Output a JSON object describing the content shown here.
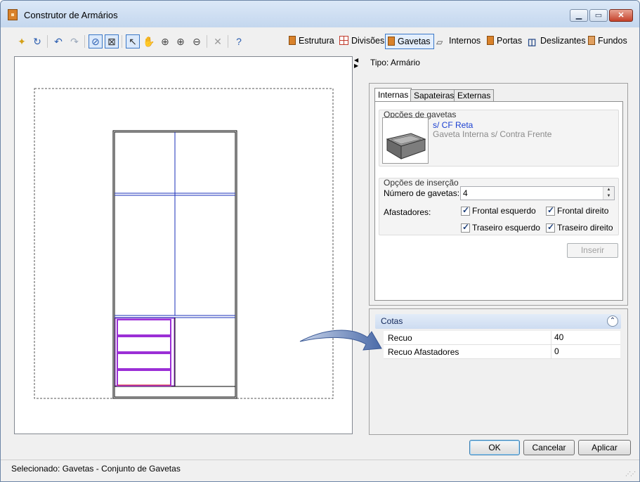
{
  "window": {
    "title": "Construtor de Armários"
  },
  "toolbar": {
    "icons": [
      "new-icon",
      "refresh-icon",
      "undo-icon",
      "redo-icon",
      "view-mode-icon",
      "frame-mode-icon",
      "select-pointer-icon",
      "pan-hand-icon",
      "zoom-extents-icon",
      "zoom-in-icon",
      "zoom-out-icon",
      "delete-icon",
      "help-icon"
    ],
    "tabs": [
      {
        "label": "Estrutura",
        "icon": "cabinet-icon"
      },
      {
        "label": "Divisões",
        "icon": "grid-icon"
      },
      {
        "label": "Gavetas",
        "icon": "drawer-icon",
        "active": true
      },
      {
        "label": "Internos",
        "icon": "internals-icon"
      },
      {
        "label": "Portas",
        "icon": "door-icon"
      },
      {
        "label": "Deslizantes",
        "icon": "sliding-doors-icon"
      },
      {
        "label": "Fundos",
        "icon": "back-panel-icon"
      }
    ]
  },
  "tipo": {
    "text": "Tipo: Armário"
  },
  "subtabs": [
    "Internas",
    "Sapateiras",
    "Externas"
  ],
  "opcoes_gavetas": {
    "title": "Opções de gavetas",
    "item_title": "s/ CF Reta",
    "item_subtitle": "Gaveta Interna s/ Contra Frente"
  },
  "opcoes_insercao": {
    "title": "Opções de inserção",
    "num_label": "Número de gavetas:",
    "num_value": "4",
    "afastadores_label": "Afastadores:",
    "checkboxes": {
      "frontal_esquerdo": "Frontal esquerdo",
      "frontal_direito": "Frontal direito",
      "traseiro_esquerdo": "Traseiro esquerdo",
      "traseiro_direito": "Traseiro direito"
    },
    "inserir": "Inserir"
  },
  "cotas": {
    "title": "Cotas",
    "rows": [
      {
        "name": "Recuo",
        "value": "40"
      },
      {
        "name": "Recuo Afastadores",
        "value": "0"
      }
    ]
  },
  "buttons": {
    "ok": "OK",
    "cancelar": "Cancelar",
    "aplicar": "Aplicar"
  },
  "status": {
    "text": "Selecionado: Gavetas - Conjunto de Gavetas"
  },
  "colors": {
    "divider_blue": "#1a2fb8",
    "selection_purple": "#9b2fd6",
    "drawer_red": "#d42020",
    "accent": "#3a78c8"
  }
}
